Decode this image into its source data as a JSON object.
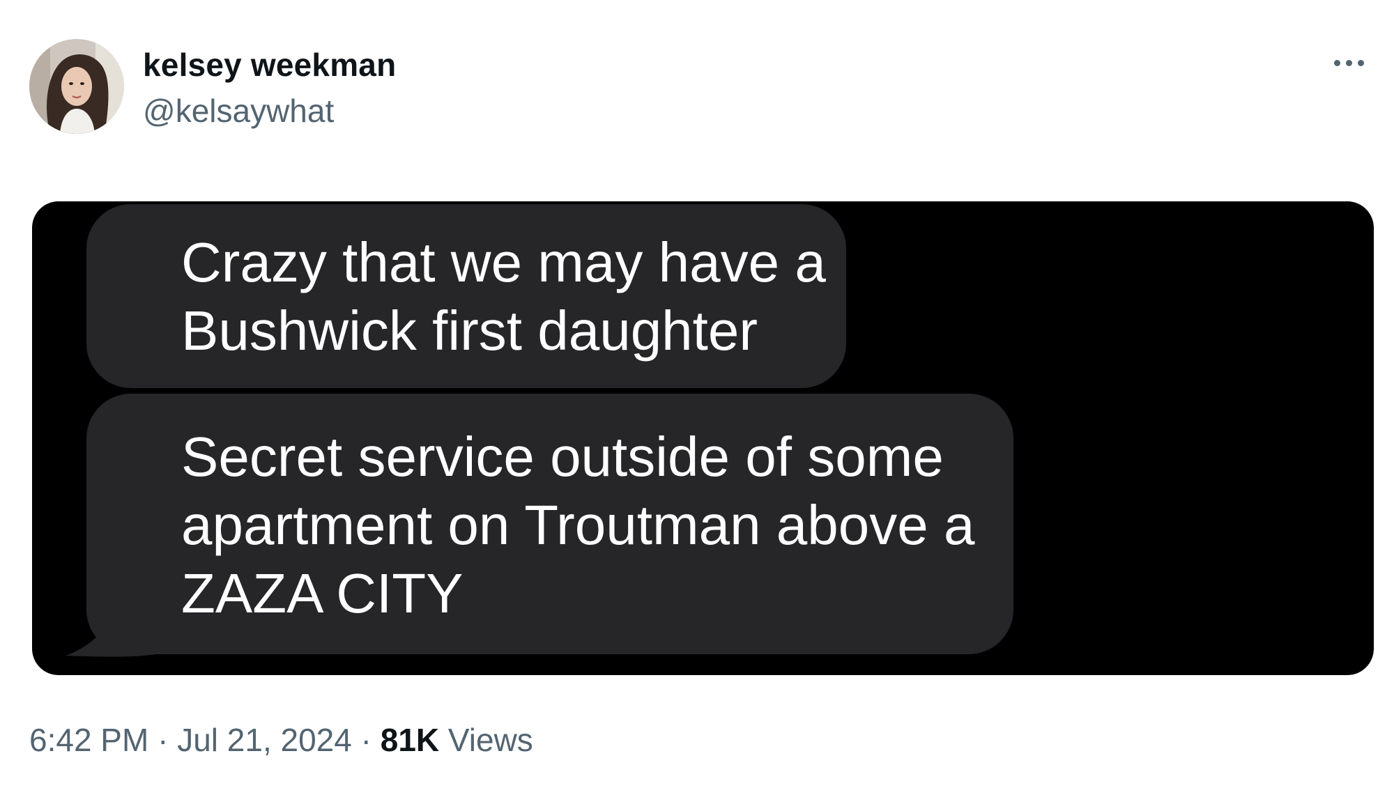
{
  "author": {
    "display_name": "kelsey weekman",
    "handle": "@kelsaywhat"
  },
  "more_icon": "ellipsis-icon",
  "media": {
    "messages": [
      {
        "lines": [
          "Crazy that we may have a",
          "Bushwick first daughter"
        ]
      },
      {
        "lines": [
          "Secret service outside of some",
          "apartment on Troutman above a",
          "ZAZA CITY"
        ]
      }
    ],
    "background_color": "#000000",
    "bubble_color": "#262629",
    "text_color": "#ffffff"
  },
  "meta": {
    "time": "6:42 PM",
    "separator_1": " · ",
    "date": "Jul 21, 2024",
    "separator_2": " · ",
    "views_count": "81K",
    "views_label": " Views"
  },
  "colors": {
    "name": "#0f1419",
    "secondary": "#536471"
  }
}
